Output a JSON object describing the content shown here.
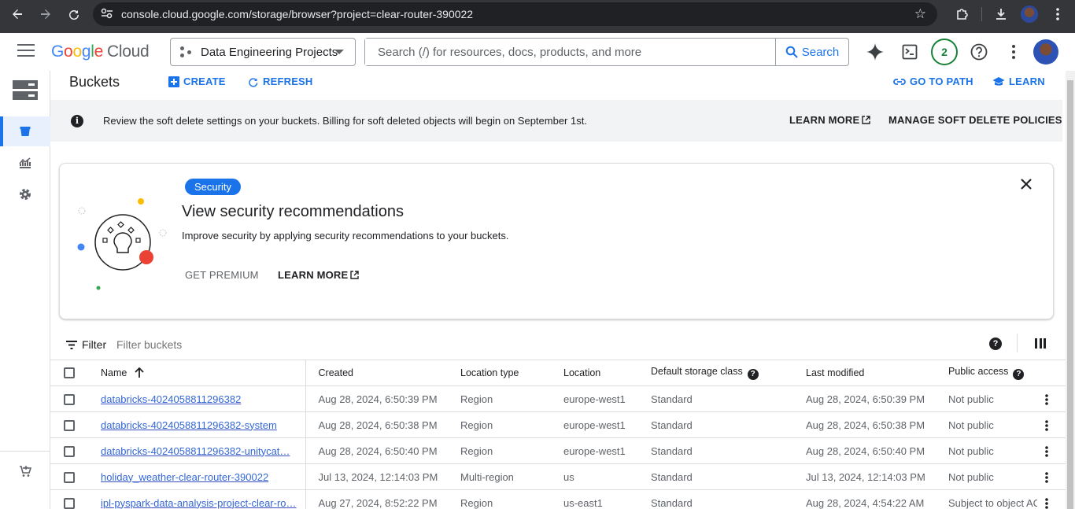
{
  "browser": {
    "url": "console.cloud.google.com/storage/browser?project=clear-router-390022"
  },
  "header": {
    "logo_letters": [
      "G",
      "o",
      "o",
      "g",
      "l",
      "e"
    ],
    "logo_product": "Cloud",
    "project_name": "Data Engineering Projects",
    "search_placeholder": "Search (/) for resources, docs, products, and more",
    "search_button": "Search",
    "notification_count": "2"
  },
  "toolbar": {
    "title": "Buckets",
    "create": "CREATE",
    "refresh": "REFRESH",
    "go_to_path": "GO TO PATH",
    "learn": "LEARN"
  },
  "banner": {
    "message": "Review the soft delete settings on your buckets. Billing for soft deleted objects will begin on September 1st.",
    "learn_more": "LEARN MORE",
    "manage": "MANAGE SOFT DELETE POLICIES"
  },
  "card": {
    "chip": "Security",
    "title": "View security recommendations",
    "description": "Improve security by applying security recommendations to your buckets.",
    "get_premium": "GET PREMIUM",
    "learn_more": "LEARN MORE"
  },
  "filter": {
    "label": "Filter",
    "placeholder": "Filter buckets"
  },
  "table": {
    "columns": {
      "name": "Name",
      "created": "Created",
      "location_type": "Location type",
      "location": "Location",
      "storage_class": "Default storage class",
      "last_modified": "Last modified",
      "public_access": "Public access"
    },
    "rows": [
      {
        "name": "databricks-4024058811296382",
        "created": "Aug 28, 2024, 6:50:39 PM",
        "location_type": "Region",
        "location": "europe-west1",
        "storage_class": "Standard",
        "last_modified": "Aug 28, 2024, 6:50:39 PM",
        "public_access": "Not public"
      },
      {
        "name": "databricks-4024058811296382-system",
        "created": "Aug 28, 2024, 6:50:38 PM",
        "location_type": "Region",
        "location": "europe-west1",
        "storage_class": "Standard",
        "last_modified": "Aug 28, 2024, 6:50:38 PM",
        "public_access": "Not public"
      },
      {
        "name": "databricks-4024058811296382-unitycat…",
        "created": "Aug 28, 2024, 6:50:40 PM",
        "location_type": "Region",
        "location": "europe-west1",
        "storage_class": "Standard",
        "last_modified": "Aug 28, 2024, 6:50:40 PM",
        "public_access": "Not public"
      },
      {
        "name": "holiday_weather-clear-router-390022",
        "created": "Jul 13, 2024, 12:14:03 PM",
        "location_type": "Multi-region",
        "location": "us",
        "storage_class": "Standard",
        "last_modified": "Jul 13, 2024, 12:14:03 PM",
        "public_access": "Not public"
      },
      {
        "name": "ipl-pyspark-data-analysis-project-clear-ro…",
        "created": "Aug 27, 2024, 8:52:22 PM",
        "location_type": "Region",
        "location": "us-east1",
        "storage_class": "Standard",
        "last_modified": "Aug 28, 2024, 4:54:22 AM",
        "public_access": "Subject to object ACL"
      }
    ]
  },
  "colors": {
    "accent": "#1a73e8",
    "chrome_bg": "#35363a",
    "banner_bg": "#f1f3f4",
    "notification_green": "#188038"
  },
  "icons": [
    "back-arrow-icon",
    "forward-arrow-icon",
    "reload-icon",
    "site-info-icon",
    "bookmark-star-icon",
    "extensions-icon",
    "download-icon",
    "menu-icon",
    "project-icon",
    "search-icon",
    "gemini-icon",
    "cloud-shell-icon",
    "help-icon",
    "more-vert-icon",
    "storage-icon",
    "bucket-icon",
    "monitoring-icon",
    "settings-icon",
    "marketplace-icon",
    "add-icon",
    "refresh-icon",
    "link-icon",
    "learn-icon",
    "info-icon",
    "external-link-icon",
    "close-icon",
    "filter-icon",
    "column-display-icon",
    "sort-arrow-up-icon"
  ]
}
